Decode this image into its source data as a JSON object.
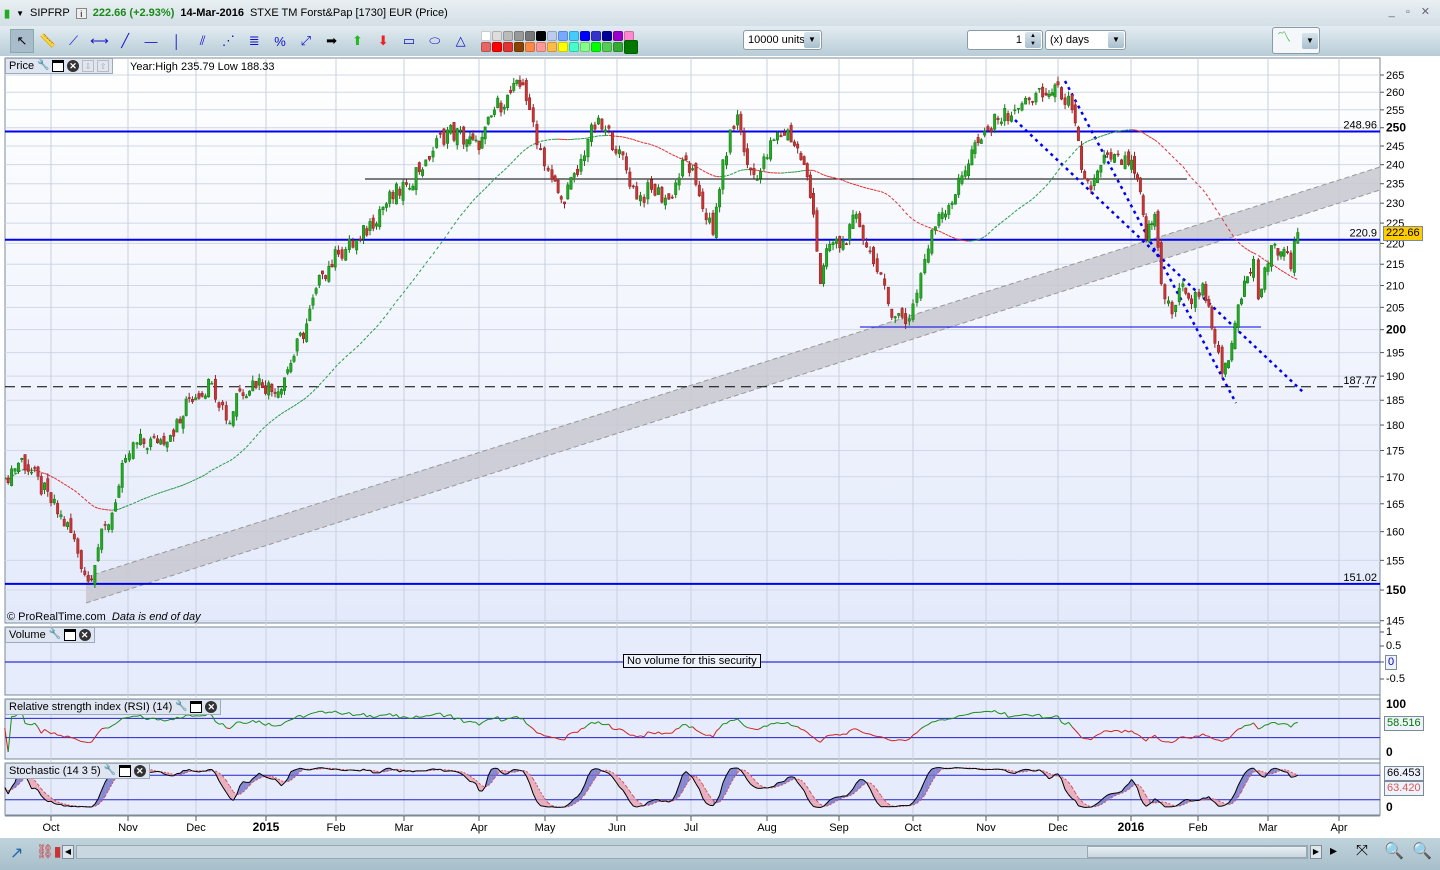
{
  "window": {
    "symbol": "SIPFRP",
    "last_price": "222.66 (+2.93%)",
    "date": "14-Mar-2016",
    "description": "STXE TM Forst&Pap [1730] EUR (Price)",
    "info_icon": "i",
    "controls": "_ ▫ ✕"
  },
  "toolbar": {
    "tools": [
      "pointer-icon",
      "ruler-icon",
      "segment-icon",
      "horizontal-segment-icon",
      "line-icon",
      "horizontal-line-icon",
      "vertical-line-icon",
      "channel-icon",
      "fan-icon",
      "fibonacci-icon",
      "percent-icon",
      "resize-icon",
      "arrow-right-icon",
      "arrow-up-icon",
      "arrow-down-icon",
      "rectangle-icon",
      "ellipse-icon",
      "triangle-icon"
    ],
    "palette_row1": [
      "#ffffff",
      "#dddddd",
      "#bbbbbb",
      "#999999",
      "#777777",
      "#000000",
      "#bbccee",
      "#77aaff",
      "#44ccff",
      "#0000ff",
      "#3333cc",
      "#000099",
      "#9900cc",
      "#ff88cc"
    ],
    "palette_row2": [
      "#e66666",
      "#ff0000",
      "#e33333",
      "#884400",
      "#ff8844",
      "#ff9999",
      "#ffbb44",
      "#ffff00",
      "#44ffcc",
      "#88ff88",
      "#00ff00",
      "#55cc55",
      "#33aa33",
      "#007700"
    ],
    "quantity": "10000 units",
    "period_value": "1",
    "period_unit": "(x) days"
  },
  "panes": {
    "price": {
      "label": "Price",
      "info": "Year:High 235.79 Low 188.33",
      "watermark": "© ProRealTime.com",
      "watermark_note": "Data is end of day"
    },
    "volume": {
      "label": "Volume",
      "message": "No volume for this security",
      "axis": [
        "1",
        "0.5",
        "0",
        "-0.5"
      ],
      "current": "0"
    },
    "rsi": {
      "label": "Relative strength index (RSI) (14)",
      "axis": [
        "100",
        "0"
      ],
      "current": "58.516"
    },
    "stochastic": {
      "label": "Stochastic (14 3 5)",
      "axis": [
        "100",
        "0"
      ],
      "current_k": "66.453",
      "current_d": "63.420"
    }
  },
  "colors": {
    "up": "#22aa22",
    "down": "#cc3333",
    "levels": "#0000ee",
    "channel": "#c8c8d0",
    "price_tag": "#ffcc00"
  },
  "chart_data": {
    "type": "candlestick",
    "scale": "log",
    "ylim": [
      145,
      268
    ],
    "y_ticks": [
      145,
      150,
      155,
      160,
      165,
      170,
      175,
      180,
      185,
      190,
      195,
      200,
      205,
      210,
      215,
      220,
      225,
      230,
      235,
      240,
      245,
      250,
      255,
      260,
      265
    ],
    "x_ticks": [
      "Oct",
      "Nov",
      "Dec",
      "2015",
      "Feb",
      "Mar",
      "Apr",
      "May",
      "Jun",
      "Jul",
      "Aug",
      "Sep",
      "Oct",
      "Nov",
      "Dec",
      "2016",
      "Feb",
      "Mar",
      "Apr"
    ],
    "last": "222.66",
    "levels": [
      {
        "value": 248.96,
        "label": "248.96",
        "style": "solid"
      },
      {
        "value": 220.9,
        "label": "220.9",
        "style": "solid"
      },
      {
        "value": 187.77,
        "label": "187.77",
        "style": "dashed"
      },
      {
        "value": 151.02,
        "label": "151.02",
        "style": "solid"
      }
    ],
    "closes": [
      [
        "2014-09-12",
        169.8
      ],
      [
        "2014-09-19",
        173.5
      ],
      [
        "2014-10-01",
        165.2
      ],
      [
        "2014-10-09",
        159.8
      ],
      [
        "2014-10-16",
        151.5
      ],
      [
        "2014-10-20",
        157.2
      ],
      [
        "2014-10-27",
        165.2
      ],
      [
        "2014-10-31",
        173.5
      ],
      [
        "2014-11-05",
        176.5
      ],
      [
        "2014-11-14",
        176.5
      ],
      [
        "2014-11-24",
        180.4
      ],
      [
        "2014-11-28",
        185.4
      ],
      [
        "2014-12-08",
        188.5
      ],
      [
        "2014-12-16",
        180.4
      ],
      [
        "2014-12-19",
        186.4
      ],
      [
        "2014-12-29",
        189.5
      ],
      [
        "2015-01-05",
        186.4
      ],
      [
        "2015-01-12",
        192.7
      ],
      [
        "2015-01-19",
        201.3
      ],
      [
        "2015-01-26",
        212.7
      ],
      [
        "2015-02-02",
        217.4
      ],
      [
        "2015-02-11",
        221.0
      ],
      [
        "2015-02-19",
        228.4
      ],
      [
        "2015-03-02",
        234.8
      ],
      [
        "2015-03-10",
        241.3
      ],
      [
        "2015-03-19",
        249.4
      ],
      [
        "2015-03-27",
        246.7
      ],
      [
        "2015-04-01",
        244.0
      ],
      [
        "2015-04-08",
        255.0
      ],
      [
        "2015-04-14",
        259.2
      ],
      [
        "2015-04-21",
        262.1
      ],
      [
        "2015-04-24",
        255.0
      ],
      [
        "2015-04-29",
        244.0
      ],
      [
        "2015-05-04",
        236.1
      ],
      [
        "2015-05-08",
        231.0
      ],
      [
        "2015-05-15",
        237.4
      ],
      [
        "2015-05-21",
        250.8
      ],
      [
        "2015-05-27",
        249.4
      ],
      [
        "2015-06-02",
        244.0
      ],
      [
        "2015-06-09",
        231.0
      ],
      [
        "2015-06-15",
        233.5
      ],
      [
        "2015-06-22",
        231.0
      ],
      [
        "2015-06-29",
        241.3
      ],
      [
        "2015-07-03",
        234.8
      ],
      [
        "2015-07-10",
        222.2
      ],
      [
        "2015-07-14",
        241.3
      ],
      [
        "2015-07-20",
        253.6
      ],
      [
        "2015-07-24",
        240.0
      ],
      [
        "2015-07-28",
        236.1
      ],
      [
        "2015-08-04",
        246.7
      ],
      [
        "2015-08-10",
        249.4
      ],
      [
        "2015-08-17",
        240.0
      ],
      [
        "2015-08-21",
        227.2
      ],
      [
        "2015-08-24",
        210.4
      ],
      [
        "2015-08-28",
        219.8
      ],
      [
        "2015-09-04",
        219.8
      ],
      [
        "2015-09-08",
        227.2
      ],
      [
        "2015-09-15",
        215.1
      ],
      [
        "2015-09-21",
        205.8
      ],
      [
        "2015-09-28",
        201.3
      ],
      [
        "2015-10-01",
        205.8
      ],
      [
        "2015-10-06",
        216.2
      ],
      [
        "2015-10-12",
        227.2
      ],
      [
        "2015-10-19",
        232.2
      ],
      [
        "2015-10-26",
        244.0
      ],
      [
        "2015-10-30",
        246.7
      ],
      [
        "2015-11-06",
        252.2
      ],
      [
        "2015-11-13",
        255.0
      ],
      [
        "2015-11-19",
        257.8
      ],
      [
        "2015-11-26",
        259.2
      ],
      [
        "2015-12-01",
        262.1
      ],
      [
        "2015-12-07",
        255.0
      ],
      [
        "2015-12-11",
        238.7
      ],
      [
        "2015-12-15",
        233.5
      ],
      [
        "2015-12-22",
        242.7
      ],
      [
        "2015-12-28",
        240.0
      ],
      [
        "2015-12-31",
        240.0
      ],
      [
        "2016-01-04",
        236.1
      ],
      [
        "2016-01-08",
        221.0
      ],
      [
        "2016-01-12",
        227.2
      ],
      [
        "2016-01-15",
        210.4
      ],
      [
        "2016-01-20",
        203.5
      ],
      [
        "2016-01-25",
        210.4
      ],
      [
        "2016-01-29",
        205.8
      ],
      [
        "2016-02-03",
        210.4
      ],
      [
        "2016-02-08",
        197.0
      ],
      [
        "2016-02-11",
        190.6
      ],
      [
        "2016-02-15",
        197.0
      ],
      [
        "2016-02-19",
        206.9
      ],
      [
        "2016-02-24",
        216.2
      ],
      [
        "2016-02-26",
        206.9
      ],
      [
        "2016-03-01",
        215.1
      ],
      [
        "2016-03-04",
        219.8
      ],
      [
        "2016-03-08",
        218.6
      ],
      [
        "2016-03-11",
        213.9
      ],
      [
        "2016-03-14",
        222.66
      ]
    ]
  }
}
